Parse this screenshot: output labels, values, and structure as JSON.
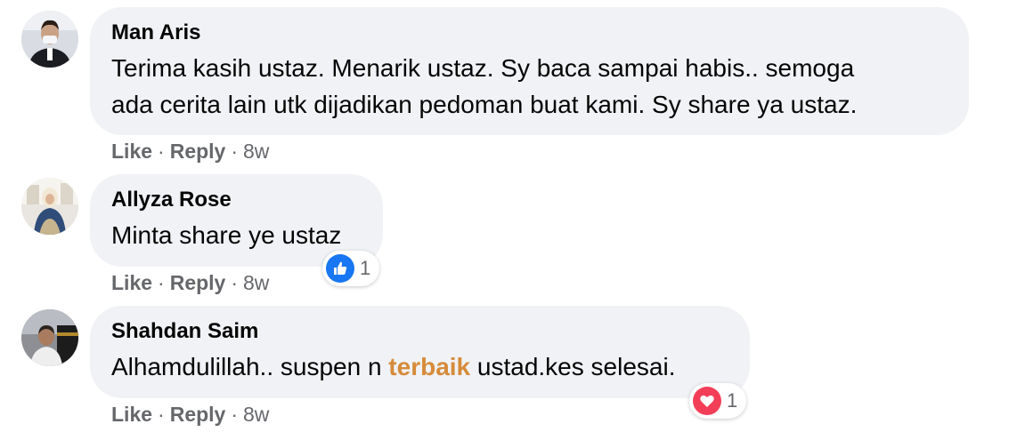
{
  "comments": [
    {
      "author": "Man Aris",
      "text_lines": [
        "Terima kasih ustaz. Menarik ustaz. Sy baca sampai habis.. semoga",
        "ada cerita lain utk dijadikan pedoman buat kami. Sy share ya ustaz."
      ],
      "actions": {
        "like": "Like",
        "reply": "Reply",
        "time": "8w",
        "dot": "·"
      }
    },
    {
      "author": "Allyza Rose",
      "text": "Minta share ye ustaz",
      "actions": {
        "like": "Like",
        "reply": "Reply",
        "time": "8w",
        "dot": "·"
      },
      "reaction": {
        "icon": "like-thumb-icon",
        "count": "1",
        "color": "#1877f2"
      }
    },
    {
      "author": "Shahdan Saim",
      "text_before": "Alhamdulillah.. suspen n ",
      "text_highlight": "terbaik",
      "text_after": " ustad.kes selesai.",
      "highlight_color": "#d68b3a",
      "actions": {
        "like": "Like",
        "reply": "Reply",
        "time": "8w",
        "dot": "·"
      },
      "reaction": {
        "icon": "love-heart-icon",
        "count": "1",
        "color": "#f33e58"
      }
    }
  ]
}
